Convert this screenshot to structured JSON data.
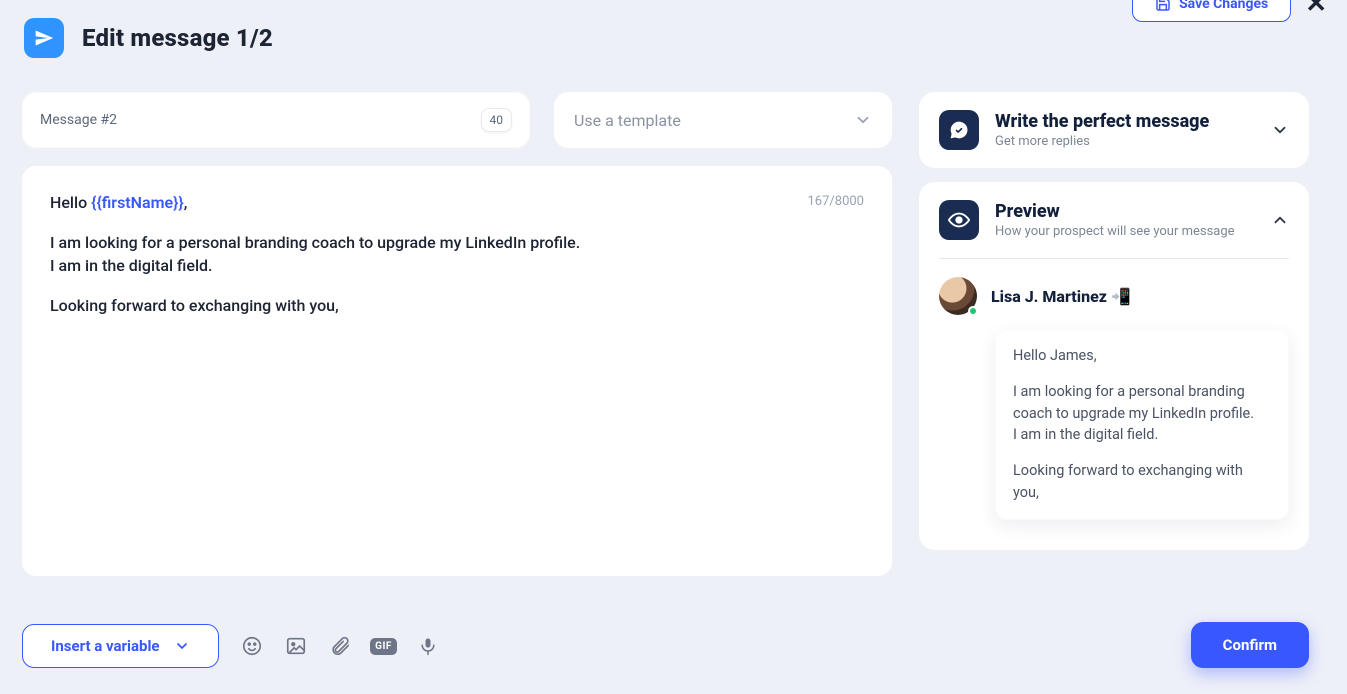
{
  "topbar": {
    "save_label": "Save Changes"
  },
  "header": {
    "title": "Edit message 1/2"
  },
  "message_field": {
    "label": "Message #2",
    "count": "40"
  },
  "template_select": {
    "placeholder": "Use a template"
  },
  "editor": {
    "char_counter": "167/8000",
    "greeting_prefix": "Hello ",
    "variable_token": "{{firstName}}",
    "greeting_suffix": ",",
    "line2": "I am looking for a personal branding coach to upgrade my LinkedIn profile.",
    "line3": "I am in the digital field.",
    "line4": "Looking forward to exchanging with you,"
  },
  "toolbar": {
    "insert_label": "Insert a variable",
    "gif_label": "GIF"
  },
  "tips_card": {
    "title": "Write the perfect message",
    "subtitle": "Get more replies"
  },
  "preview_card": {
    "title": "Preview",
    "subtitle": "How your prospect will see your message",
    "person_name": "Lisa J. Martinez 📲",
    "bubble": {
      "l1": "Hello James,",
      "l2": "I am looking for a personal branding coach to upgrade my LinkedIn profile.",
      "l3": "I am in the digital field.",
      "l4": "Looking forward to exchanging with you,"
    }
  },
  "confirm_label": "Confirm"
}
